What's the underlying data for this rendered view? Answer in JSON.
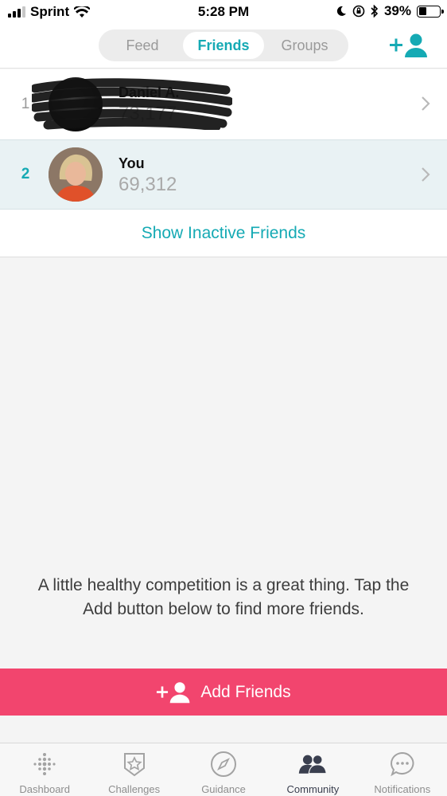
{
  "status_bar": {
    "carrier": "Sprint",
    "time": "5:28 PM",
    "battery": "39%",
    "battery_level": 0.39
  },
  "header": {
    "tabs": [
      {
        "label": "Feed",
        "active": false
      },
      {
        "label": "Friends",
        "active": true
      },
      {
        "label": "Groups",
        "active": false
      }
    ],
    "add_friend_icon": "add-person-icon"
  },
  "leaderboard": [
    {
      "rank": "1",
      "name": "Daniel A.",
      "steps": "73,177",
      "redacted": true
    },
    {
      "rank": "2",
      "name": "You",
      "steps": "69,312",
      "redacted": false
    }
  ],
  "show_inactive_label": "Show Inactive Friends",
  "empty_message": "A little healthy competition is a great thing. Tap the Add button below to find more friends.",
  "add_friends_label": "Add Friends",
  "tabbar": {
    "items": [
      {
        "label": "Dashboard",
        "icon": "dots-grid-icon"
      },
      {
        "label": "Challenges",
        "icon": "star-badge-icon"
      },
      {
        "label": "Guidance",
        "icon": "compass-icon"
      },
      {
        "label": "Community",
        "icon": "people-icon",
        "active": true
      },
      {
        "label": "Notifications",
        "icon": "chat-bubble-icon"
      }
    ]
  },
  "colors": {
    "accent": "#15aab4",
    "add_bar": "#f2456e",
    "selected_row": "#e9f2f4"
  }
}
